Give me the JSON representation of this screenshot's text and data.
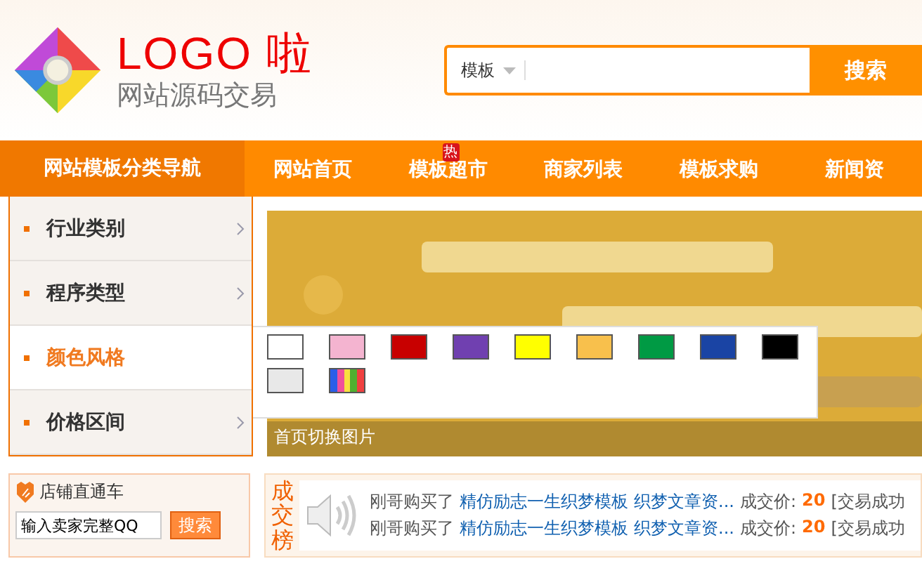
{
  "logo": {
    "title": "LOGO 啦",
    "subtitle": "网站源码交易"
  },
  "search": {
    "category": "模板",
    "button": "搜索"
  },
  "nav": {
    "category_title": "网站模板分类导航",
    "items": [
      {
        "label": "网站首页"
      },
      {
        "label": "模板超市",
        "badge": "热"
      },
      {
        "label": "商家列表"
      },
      {
        "label": "模板求购"
      },
      {
        "label": "新闻资"
      }
    ]
  },
  "sidebar": {
    "items": [
      {
        "label": "行业类别",
        "selected": false
      },
      {
        "label": "程序类型",
        "selected": false
      },
      {
        "label": "颜色风格",
        "selected": true
      },
      {
        "label": "价格区间",
        "selected": false
      }
    ]
  },
  "color_popup": {
    "swatches": [
      {
        "kind": "solid",
        "color": "#ffffff"
      },
      {
        "kind": "solid",
        "color": "#f4b4d0"
      },
      {
        "kind": "solid",
        "color": "#c80000"
      },
      {
        "kind": "solid",
        "color": "#7040b0"
      },
      {
        "kind": "solid",
        "color": "#ffff00"
      },
      {
        "kind": "solid",
        "color": "#f8c04c"
      },
      {
        "kind": "solid",
        "color": "#009a44"
      },
      {
        "kind": "solid",
        "color": "#1a44a4"
      },
      {
        "kind": "solid",
        "color": "#000000"
      },
      {
        "kind": "solid",
        "color": "#e8e8e8"
      },
      {
        "kind": "rainbow"
      }
    ]
  },
  "banner": {
    "kind": "picture",
    "caption": "首页切换图片"
  },
  "shop_box": {
    "title": "店铺直通车",
    "input_value": "输入卖家完整QQ",
    "button": "搜索"
  },
  "deals": {
    "title": "成交榜",
    "rows": [
      {
        "buyer": "刚哥购买了",
        "item": "精仿励志一生织梦模板",
        "category": "织梦文章资...",
        "price_label": "成交价:",
        "price": "20",
        "status": "[交易成功"
      },
      {
        "buyer": "刚哥购买了",
        "item": "精仿励志一生织梦模板",
        "category": "织梦文章资...",
        "price_label": "成交价:",
        "price": "20",
        "status": "[交易成功"
      }
    ]
  }
}
